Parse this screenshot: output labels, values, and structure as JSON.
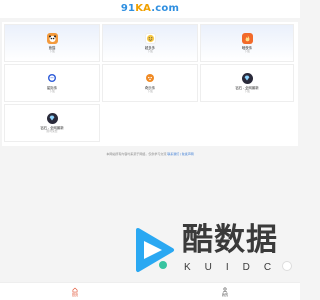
{
  "header": {
    "logo_part1": "91",
    "logo_part2": "KA",
    "logo_part3": ".com"
  },
  "apps": [
    {
      "title": "熊猫",
      "subtitle": "下载",
      "icon": "panda-icon",
      "color": "#f39a3d"
    },
    {
      "title": "超多多",
      "subtitle": "下载",
      "icon": "smiley-icon",
      "color": "#f7c948"
    },
    {
      "title": "暗夜传",
      "subtitle": "下载",
      "icon": "flame-icon",
      "color": "#f26a2a"
    },
    {
      "title": "星际传",
      "subtitle": "下载",
      "icon": "chat-bubble-icon",
      "color": "#2d5bd8"
    },
    {
      "title": "奇乐传",
      "subtitle": "下载",
      "icon": "fox-icon",
      "color": "#f08a24"
    },
    {
      "title": "钻石 - 全网最新",
      "subtitle": "下载",
      "icon": "diamond-icon",
      "color": "#2a2a3a"
    },
    {
      "title": "钻石 - 全网最新",
      "subtitle": "限时免费",
      "icon": "diamond-icon",
      "color": "#2a2a3a"
    }
  ],
  "footer": {
    "note": "本网站所有内容均来源于网络，仅供学习交流 ",
    "link": "联系我们 | 免责声明"
  },
  "watermark": {
    "title": "酷数据",
    "subtitle": "KUIDC"
  },
  "tabbar": {
    "tabs": [
      {
        "label": "首页",
        "icon": "home-icon",
        "active": true
      },
      {
        "label": "我的",
        "icon": "user-icon",
        "active": false
      }
    ]
  },
  "colors": {
    "accent": "#e04b2b",
    "brand_blue": "#2f8fe0",
    "brand_orange": "#f0a000"
  }
}
